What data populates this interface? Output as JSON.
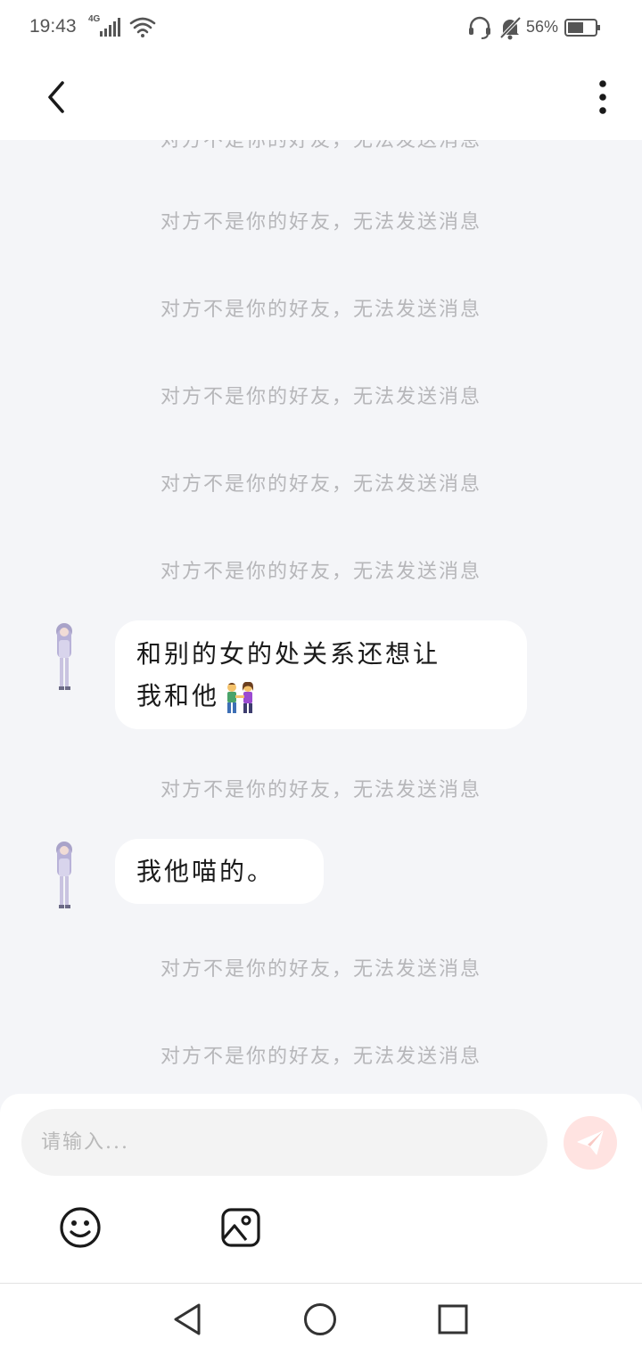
{
  "status_bar": {
    "time": "19:43",
    "network": "4G",
    "battery": "56%"
  },
  "header": {
    "back_icon": "chevron-left-icon",
    "more_icon": "more-vertical-icon"
  },
  "chat": {
    "system_notice": "对方不是你的好友，无法发送消息",
    "messages": [
      {
        "type": "system",
        "text": "对方不是你的好友，无法发送消息"
      },
      {
        "type": "system",
        "text": "对方不是你的好友，无法发送消息"
      },
      {
        "type": "system",
        "text": "对方不是你的好友，无法发送消息"
      },
      {
        "type": "system",
        "text": "对方不是你的好友，无法发送消息"
      },
      {
        "type": "system",
        "text": "对方不是你的好友，无法发送消息"
      },
      {
        "type": "system",
        "text": "对方不是你的好友，无法发送消息"
      },
      {
        "type": "user",
        "line1": "和别的女的处关系还想让",
        "line2": "我和他",
        "emoji": "couple-emoji"
      },
      {
        "type": "system",
        "text": "对方不是你的好友，无法发送消息"
      },
      {
        "type": "user",
        "line1": "我他喵的。"
      },
      {
        "type": "system",
        "text": "对方不是你的好友，无法发送消息"
      },
      {
        "type": "system",
        "text": "对方不是你的好友，无法发送消息"
      }
    ]
  },
  "composer": {
    "placeholder": "请输入...",
    "send_icon": "send-icon",
    "emoji_icon": "smiley-icon",
    "image_icon": "image-icon",
    "send_color": "#ffe3e1"
  },
  "nav_bar": {
    "back_icon": "triangle-back-icon",
    "home_icon": "circle-home-icon",
    "recent_icon": "square-recent-icon"
  }
}
